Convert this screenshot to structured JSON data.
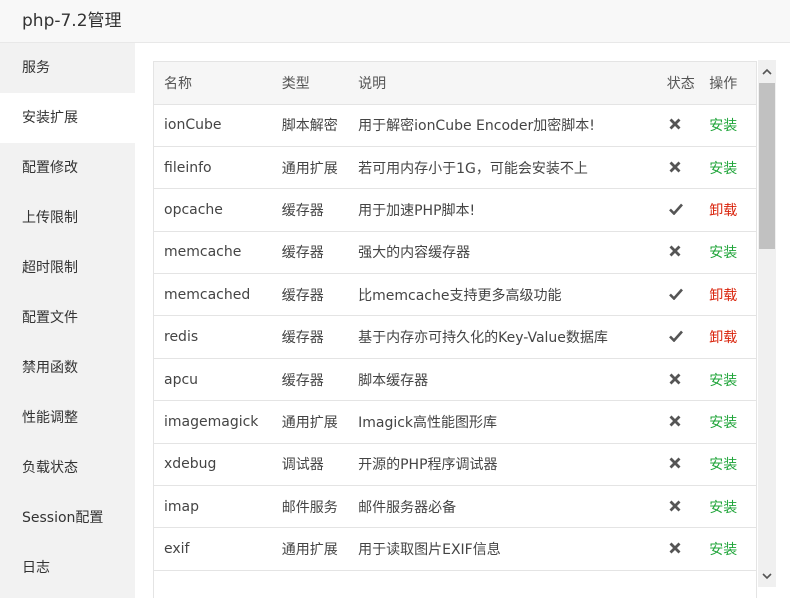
{
  "window": {
    "title": "php-7.2管理"
  },
  "sidebar": {
    "items": [
      {
        "label": "服务"
      },
      {
        "label": "安装扩展",
        "active": true
      },
      {
        "label": "配置修改"
      },
      {
        "label": "上传限制"
      },
      {
        "label": "超时限制"
      },
      {
        "label": "配置文件"
      },
      {
        "label": "禁用函数"
      },
      {
        "label": "性能调整"
      },
      {
        "label": "负载状态"
      },
      {
        "label": "Session配置"
      },
      {
        "label": "日志"
      }
    ]
  },
  "table": {
    "headers": [
      "名称",
      "类型",
      "说明",
      "状态",
      "操作"
    ],
    "rows": [
      {
        "name": "ionCube",
        "type": "脚本解密",
        "desc": "用于解密ionCube Encoder加密脚本!",
        "installed": false,
        "action": "安装"
      },
      {
        "name": "fileinfo",
        "type": "通用扩展",
        "desc": "若可用内存小于1G，可能会安装不上",
        "installed": false,
        "action": "安装"
      },
      {
        "name": "opcache",
        "type": "缓存器",
        "desc": "用于加速PHP脚本!",
        "installed": true,
        "action": "卸载"
      },
      {
        "name": "memcache",
        "type": "缓存器",
        "desc": "强大的内容缓存器",
        "installed": false,
        "action": "安装"
      },
      {
        "name": "memcached",
        "type": "缓存器",
        "desc": "比memcache支持更多高级功能",
        "installed": true,
        "action": "卸载"
      },
      {
        "name": "redis",
        "type": "缓存器",
        "desc": "基于内存亦可持久化的Key-Value数据库",
        "installed": true,
        "action": "卸载"
      },
      {
        "name": "apcu",
        "type": "缓存器",
        "desc": "脚本缓存器",
        "installed": false,
        "action": "安装"
      },
      {
        "name": "imagemagick",
        "type": "通用扩展",
        "desc": "Imagick高性能图形库",
        "installed": false,
        "action": "安装"
      },
      {
        "name": "xdebug",
        "type": "调试器",
        "desc": "开源的PHP程序调试器",
        "installed": false,
        "action": "安装"
      },
      {
        "name": "imap",
        "type": "邮件服务",
        "desc": "邮件服务器必备",
        "installed": false,
        "action": "安装"
      },
      {
        "name": "exif",
        "type": "通用扩展",
        "desc": "用于读取图片EXIF信息",
        "installed": false,
        "action": "安装"
      }
    ]
  },
  "icons": {
    "installed": "check-icon",
    "not_installed": "cross-icon",
    "scroll_up": "chevron-up-icon",
    "scroll_down": "chevron-down-icon"
  },
  "colors": {
    "install": "#20a53a",
    "uninstall": "#d9230b"
  }
}
